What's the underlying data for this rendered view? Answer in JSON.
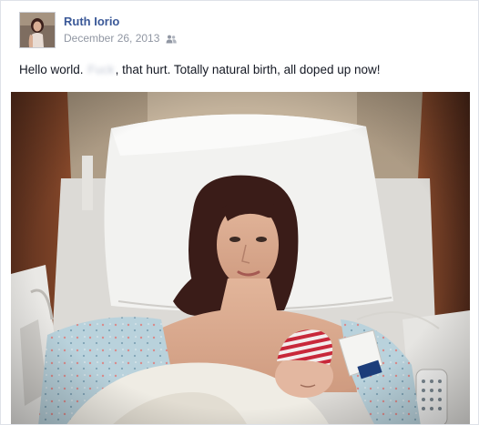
{
  "post": {
    "author": "Ruth Iorio",
    "date": "December 26, 2013",
    "text_before": "Hello world.",
    "redacted_word": "Fuck",
    "text_after": ", that hurt. Totally natural birth, all doped up now!",
    "audience_icon": "friends-icon",
    "photo": "hospital-bed-newborn-photo"
  },
  "colors": {
    "link": "#3b5998",
    "meta": "#9197a3",
    "text": "#141823"
  }
}
